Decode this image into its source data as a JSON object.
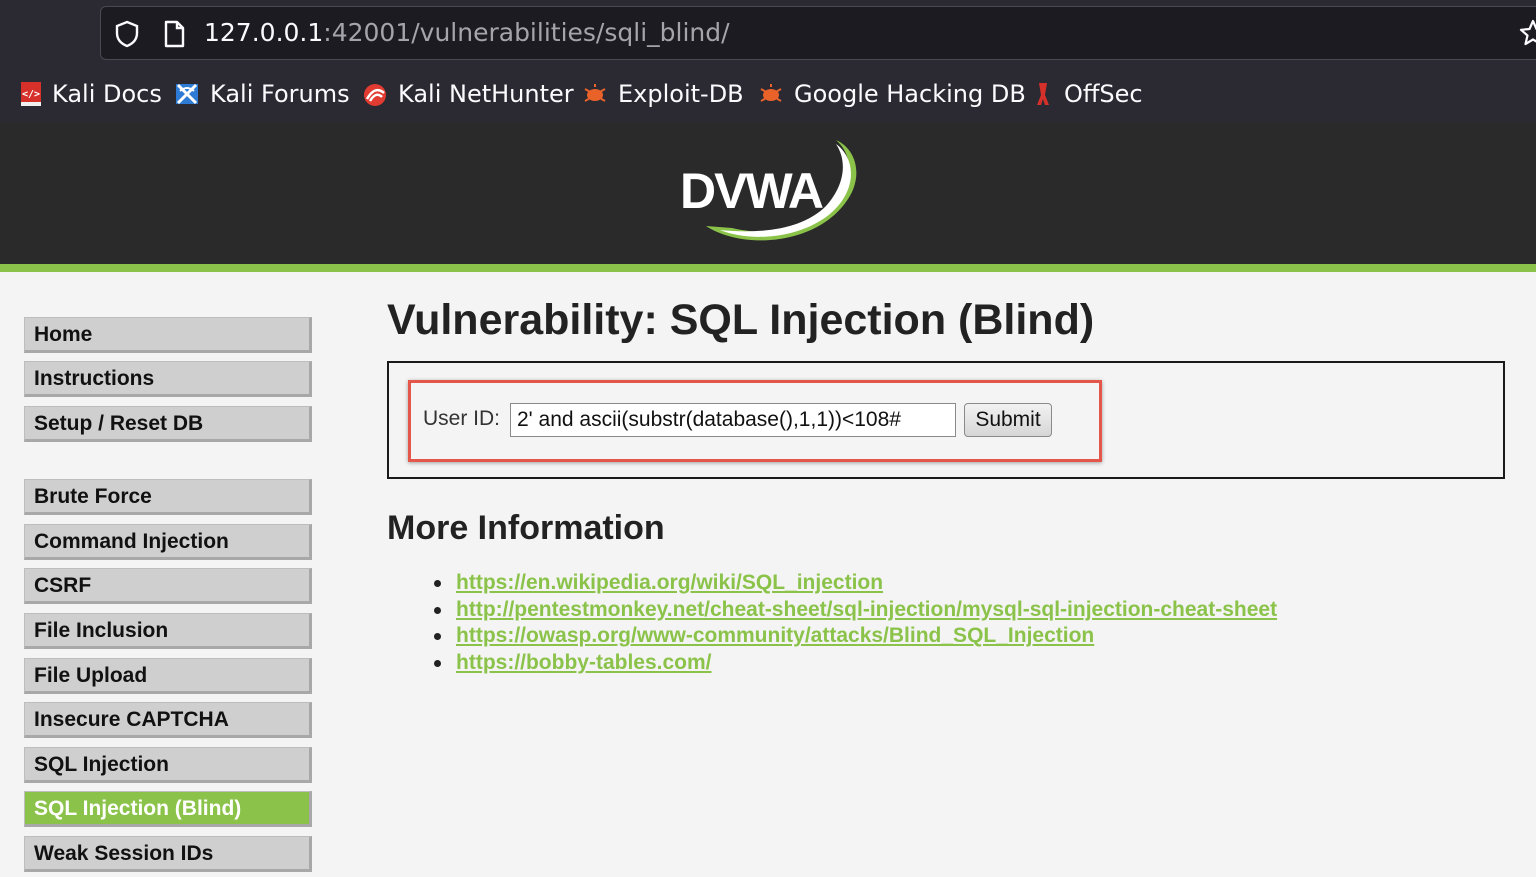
{
  "browser": {
    "url_host": "127.0.0.1",
    "url_rest": ":42001/vulnerabilities/sqli_blind/",
    "bookmarks": [
      {
        "label": "Kali Docs",
        "icon": "kali-docs-icon"
      },
      {
        "label": "Kali Forums",
        "icon": "kali-forums-icon"
      },
      {
        "label": "Kali NetHunter",
        "icon": "kali-nethunter-icon"
      },
      {
        "label": "Exploit-DB",
        "icon": "exploit-db-icon"
      },
      {
        "label": "Google Hacking DB",
        "icon": "google-hacking-db-icon"
      },
      {
        "label": "OffSec",
        "icon": "offsec-icon"
      }
    ]
  },
  "header": {
    "logo_text": "DVWA",
    "accent_color": "#8bc34a"
  },
  "sidebar": {
    "groups": [
      [
        "Home",
        "Instructions",
        "Setup / Reset DB"
      ],
      [
        "Brute Force",
        "Command Injection",
        "CSRF",
        "File Inclusion",
        "File Upload",
        "Insecure CAPTCHA",
        "SQL Injection",
        "SQL Injection (Blind)",
        "Weak Session IDs"
      ]
    ],
    "active_item": "SQL Injection (Blind)"
  },
  "main": {
    "title": "Vulnerability: SQL Injection (Blind)",
    "form": {
      "label": "User ID:",
      "input_value": "2' and ascii(substr(database(),1,1))<108#",
      "submit_label": "Submit"
    },
    "more_info_title": "More Information",
    "links": [
      "https://en.wikipedia.org/wiki/SQL_injection",
      "http://pentestmonkey.net/cheat-sheet/sql-injection/mysql-sql-injection-cheat-sheet",
      "https://owasp.org/www-community/attacks/Blind_SQL_Injection",
      "https://bobby-tables.com/"
    ]
  }
}
